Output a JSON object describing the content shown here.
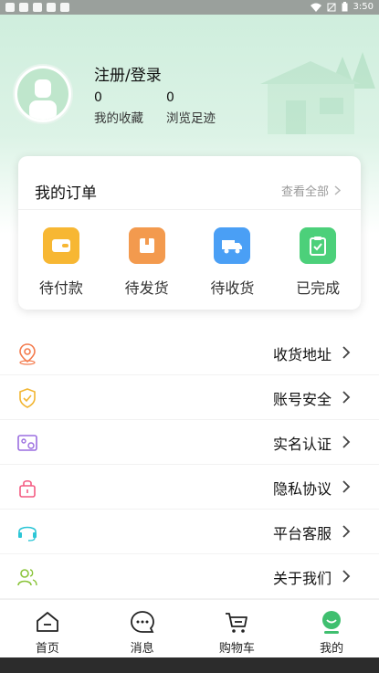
{
  "status_bar": {
    "time": "3:50"
  },
  "profile": {
    "login_label": "注册/登录",
    "favorites": {
      "count": "0",
      "label": "我的收藏"
    },
    "history": {
      "count": "0",
      "label": "浏览足迹"
    }
  },
  "orders": {
    "title": "我的订单",
    "view_all": "查看全部",
    "items": [
      {
        "label": "待付款",
        "icon": "wallet-icon",
        "color": "#f7b733"
      },
      {
        "label": "待发货",
        "icon": "package-icon",
        "color": "#f39a4e"
      },
      {
        "label": "待收货",
        "icon": "truck-icon",
        "color": "#4a9ff5"
      },
      {
        "label": "已完成",
        "icon": "clipboard-check-icon",
        "color": "#4cd07a"
      }
    ]
  },
  "menu": {
    "items": [
      {
        "label": "收货地址",
        "icon": "location-icon",
        "color": "#f47b4d"
      },
      {
        "label": "账号安全",
        "icon": "shield-icon",
        "color": "#f2b531"
      },
      {
        "label": "实名认证",
        "icon": "id-card-icon",
        "color": "#9b6ee0"
      },
      {
        "label": "隐私协议",
        "icon": "lock-icon",
        "color": "#f45b82"
      },
      {
        "label": "平台客服",
        "icon": "headset-icon",
        "color": "#2dc6d6"
      },
      {
        "label": "关于我们",
        "icon": "users-icon",
        "color": "#8ac43a"
      }
    ]
  },
  "nav": {
    "items": [
      {
        "label": "首页",
        "icon": "home-icon"
      },
      {
        "label": "消息",
        "icon": "message-icon"
      },
      {
        "label": "购物车",
        "icon": "cart-icon"
      },
      {
        "label": "我的",
        "icon": "profile-icon",
        "active": true
      }
    ],
    "accent": "#3fbf6f"
  }
}
